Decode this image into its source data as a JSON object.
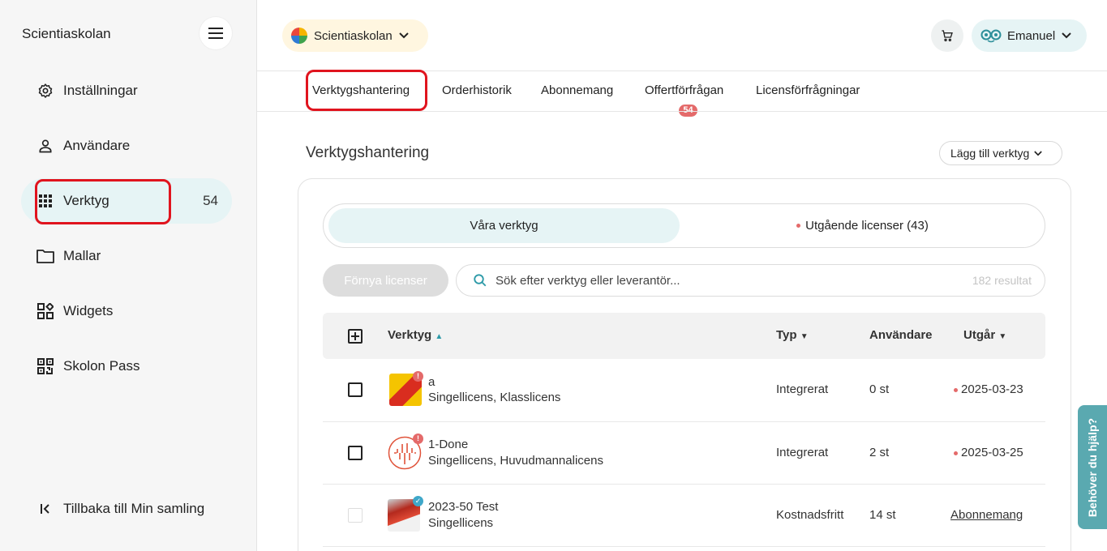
{
  "sidebar": {
    "brand": "Scientiaskolan",
    "items": [
      {
        "label": "Inställningar",
        "icon": "gear-icon"
      },
      {
        "label": "Användare",
        "icon": "user-icon"
      },
      {
        "label": "Verktyg",
        "icon": "grid-icon",
        "count": "54",
        "active": true
      },
      {
        "label": "Mallar",
        "icon": "folder-icon"
      },
      {
        "label": "Widgets",
        "icon": "widgets-icon"
      },
      {
        "label": "Skolon Pass",
        "icon": "qr-icon"
      }
    ],
    "back_label": "Tillbaka till Min samling"
  },
  "header": {
    "school": "Scientiaskolan",
    "user": "Emanuel"
  },
  "tabs": [
    {
      "label": "Verktygshantering",
      "active": true
    },
    {
      "label": "Orderhistorik"
    },
    {
      "label": "Abonnemang"
    },
    {
      "label": "Offertförfrågan",
      "badge": "54"
    },
    {
      "label": "Licensförfrågningar"
    }
  ],
  "main": {
    "title": "Verktygshantering",
    "add_tool": "Lägg till verktyg",
    "segments": {
      "ours": "Våra verktyg",
      "expiring": "Utgående licenser (43)"
    },
    "renew": "Förnya licenser",
    "search_placeholder": "Sök efter verktyg eller leverantör...",
    "results": "182 resultat",
    "columns": {
      "tool": "Verktyg",
      "type": "Typ",
      "users": "Användare",
      "expires": "Utgår"
    },
    "rows": [
      {
        "name": "a",
        "license": "Singellicens, Klasslicens",
        "type": "Integrerat",
        "users": "0 st",
        "expires": "2025-03-23",
        "status": "warning"
      },
      {
        "name": "1-Done",
        "license": "Singellicens, Huvudmannalicens",
        "type": "Integrerat",
        "users": "2 st",
        "expires": "2025-03-25",
        "status": "warning"
      },
      {
        "name": "2023-50 Test",
        "license": "Singellicens",
        "type": "Kostnadsfritt",
        "users": "14 st",
        "expires": "Abonnemang",
        "status": "verified"
      }
    ]
  },
  "help": "Behöver du hjälp?",
  "colors": {
    "accent": "#e6f4f5",
    "warning": "#e46a6a",
    "verified": "#3fa7c9",
    "annotation": "#e0141e"
  }
}
